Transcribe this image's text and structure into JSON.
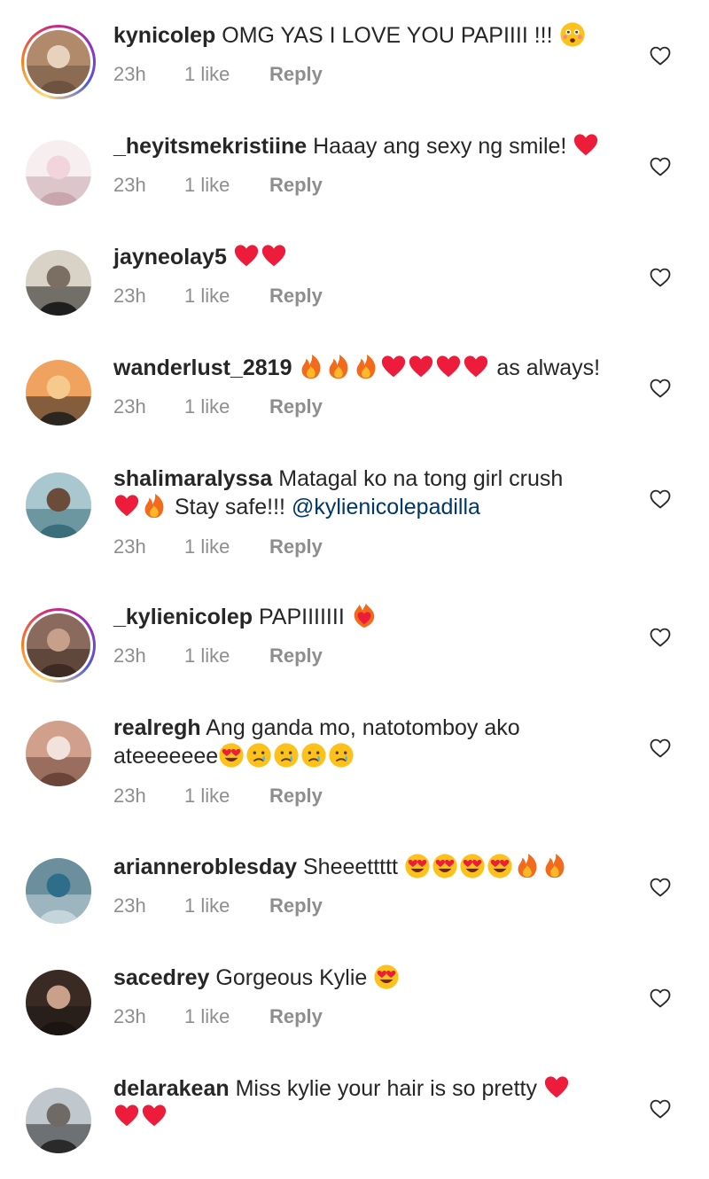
{
  "comments": [
    {
      "username": "kynicolep",
      "text": "OMG YAS I LOVE YOU PAPIIII !!!",
      "emojis": [
        "flushed"
      ],
      "time": "23h",
      "likes": "1 like",
      "reply": "Reply",
      "story_ring": true
    },
    {
      "username": "_heyitsmekristiine",
      "text": "Haaay ang sexy ng smile!",
      "emojis": [
        "red-heart"
      ],
      "time": "23h",
      "likes": "1 like",
      "reply": "Reply",
      "story_ring": false
    },
    {
      "username": "jayneolay5",
      "text": "",
      "emojis": [
        "red-heart",
        "red-heart"
      ],
      "time": "23h",
      "likes": "1 like",
      "reply": "Reply",
      "story_ring": false
    },
    {
      "username": "wanderlust_2819",
      "text": "",
      "emojis": [
        "fire",
        "fire",
        "fire",
        "red-heart",
        "red-heart",
        "red-heart",
        "red-heart"
      ],
      "text_after": "as always!",
      "time": "23h",
      "likes": "1 like",
      "reply": "Reply",
      "story_ring": false
    },
    {
      "username": "shalimaralyssa",
      "text": "Matagal ko na tong girl crush",
      "emojis_line2": [
        "red-heart",
        "fire"
      ],
      "text_line2": "Stay safe!!!",
      "mention": "@kylienicolepadilla",
      "time": "23h",
      "likes": "1 like",
      "reply": "Reply",
      "story_ring": false
    },
    {
      "username": "_kylienicolep",
      "text": "PAPIIIIIII",
      "emojis": [
        "heart-on-fire"
      ],
      "time": "23h",
      "likes": "1 like",
      "reply": "Reply",
      "story_ring": true
    },
    {
      "username": "realregh",
      "text": "Ang ganda mo, natotomboy ako",
      "text_line2": "ateeeeeee",
      "emojis_line2": [
        "heart-eyes",
        "crying",
        "crying",
        "crying",
        "crying"
      ],
      "time": "23h",
      "likes": "1 like",
      "reply": "Reply",
      "story_ring": false
    },
    {
      "username": "arianneroblesday",
      "text": "Sheeettttt",
      "emojis": [
        "heart-eyes",
        "heart-eyes",
        "heart-eyes",
        "heart-eyes",
        "fire",
        "fire"
      ],
      "time": "23h",
      "likes": "1 like",
      "reply": "Reply",
      "story_ring": false
    },
    {
      "username": "sacedrey",
      "text": "Gorgeous Kylie",
      "emojis": [
        "heart-eyes"
      ],
      "time": "23h",
      "likes": "1 like",
      "reply": "Reply",
      "story_ring": false
    },
    {
      "username": "delarakean",
      "text": "Miss kylie your hair is so pretty",
      "emojis": [
        "red-heart"
      ],
      "emojis_line2": [
        "red-heart",
        "red-heart"
      ],
      "time": "",
      "likes": "",
      "reply": "",
      "story_ring": false
    }
  ],
  "colors": {
    "text": "#262626",
    "meta": "#8e8e8e",
    "mention": "#00376b",
    "heart": "#ed1c3b",
    "fire": "#f26a1b"
  }
}
